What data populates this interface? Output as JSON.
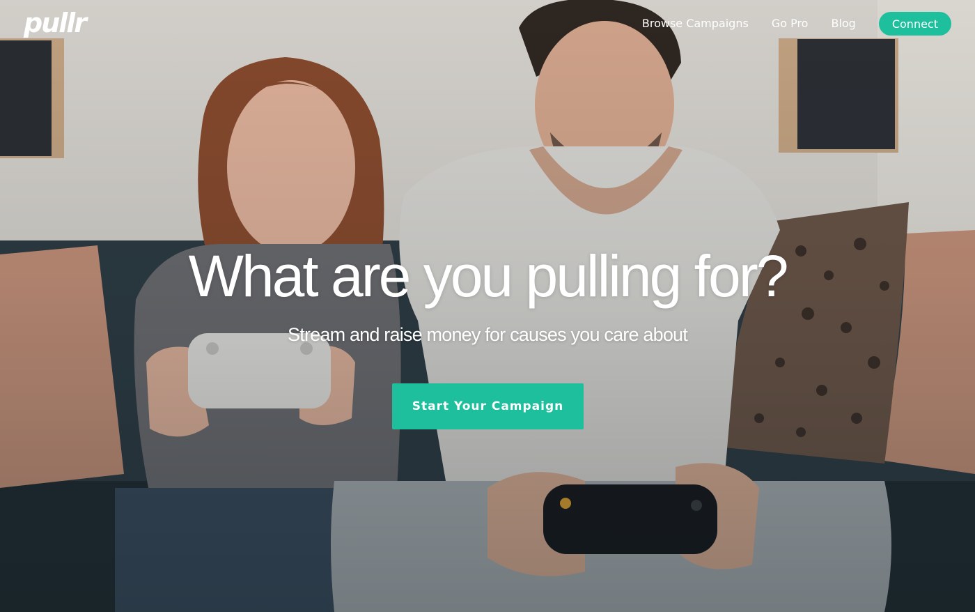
{
  "brand": {
    "logo_text": "pullr",
    "accent_color": "#1dbf9c"
  },
  "nav": {
    "links": [
      {
        "label": "Browse Campaigns"
      },
      {
        "label": "Go Pro"
      },
      {
        "label": "Blog"
      }
    ],
    "connect_label": "Connect"
  },
  "hero": {
    "headline": "What are you pulling for?",
    "subheadline": "Stream and raise money for causes you care about",
    "cta_label": "Start Your Campaign",
    "background_image": "photo of two people on a couch playing video games"
  }
}
